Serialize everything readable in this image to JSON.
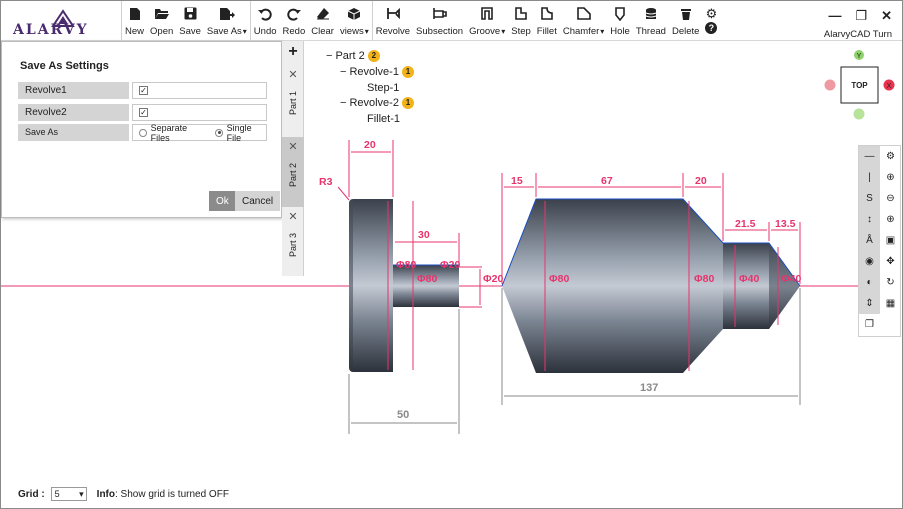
{
  "app": {
    "logo_text": "ALARVY",
    "title": "AlarvyCAD Turn"
  },
  "toolbar": {
    "file": [
      {
        "label": "New",
        "icon": "new-file-icon"
      },
      {
        "label": "Open",
        "icon": "folder-open-icon"
      },
      {
        "label": "Save",
        "icon": "save-icon"
      },
      {
        "label": "Save As",
        "icon": "save-as-icon",
        "dropdown": true
      }
    ],
    "edit": [
      {
        "label": "Undo",
        "icon": "undo-icon"
      },
      {
        "label": "Redo",
        "icon": "redo-icon"
      },
      {
        "label": "Clear",
        "icon": "eraser-icon"
      },
      {
        "label": "views",
        "icon": "cube-icon",
        "dropdown": true
      }
    ],
    "features": [
      {
        "label": "Revolve",
        "icon": "revolve-icon"
      },
      {
        "label": "Subsection",
        "icon": "subsection-icon"
      },
      {
        "label": "Groove",
        "icon": "groove-icon",
        "dropdown": true
      },
      {
        "label": "Step",
        "icon": "step-icon"
      },
      {
        "label": "Fillet",
        "icon": "fillet-icon"
      },
      {
        "label": "Chamfer",
        "icon": "chamfer-icon",
        "dropdown": true
      },
      {
        "label": "Hole",
        "icon": "hole-icon"
      },
      {
        "label": "Thread",
        "icon": "thread-icon"
      },
      {
        "label": "Delete",
        "icon": "trash-icon"
      }
    ]
  },
  "dialog": {
    "title": "Save As Settings",
    "rows": [
      {
        "label": "Revolve1",
        "checked": true
      },
      {
        "label": "Revolve2",
        "checked": true
      }
    ],
    "save_as": {
      "label": "Save As",
      "options": [
        "Separate Files",
        "Single File"
      ],
      "selected": "Single File"
    },
    "ok_label": "Ok",
    "cancel_label": "Cancel"
  },
  "part_tabs": [
    {
      "label": "Part 1",
      "active": false
    },
    {
      "label": "Part 2",
      "active": true
    },
    {
      "label": "Part 3",
      "active": false
    }
  ],
  "tree": {
    "root": {
      "label": "Part 2",
      "badge": "2"
    },
    "children": [
      {
        "label": "Revolve-1",
        "badge": "1",
        "children": [
          "Step-1"
        ]
      },
      {
        "label": "Revolve-2",
        "badge": "1",
        "children": [
          "Fillet-1"
        ]
      }
    ]
  },
  "viewcube": {
    "face": "TOP",
    "y_label": "Y",
    "x_label": "X"
  },
  "dimensions": {
    "part1": {
      "fillet": "R3",
      "shoulder_len": "20",
      "shaft_len": "30",
      "total_len": "50",
      "dia_big": "Φ80",
      "dia_shaft": "Φ80",
      "dia_end": "Φ20"
    },
    "part2": {
      "chamfer_len": "15",
      "body_len": "67",
      "taper_len": "20",
      "step_len": "21.5",
      "tip_len": "13.5",
      "total_len": "137",
      "dia_start": "Φ20",
      "dia_body": "Φ80",
      "dia_body2": "Φ80",
      "dia_step": "Φ40",
      "dia_tip": "Φ40"
    }
  },
  "status": {
    "grid_label": "Grid :",
    "grid_value": "5",
    "info_label": "Info",
    "info_text": ": Show grid is turned OFF"
  },
  "colors": {
    "dimension": "#e8336d",
    "axis": "#e8336d",
    "part_fill": "#6e7684",
    "badge": "#f2b21a"
  }
}
